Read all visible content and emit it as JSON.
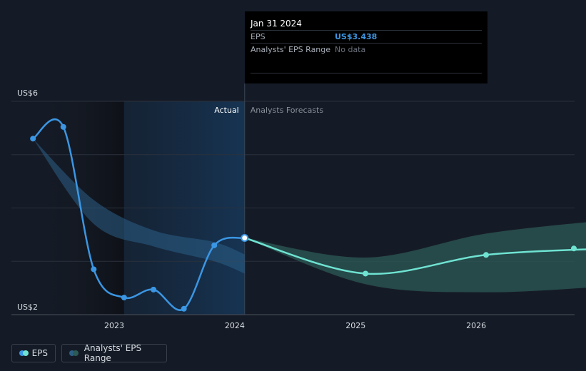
{
  "chart_data": {
    "type": "line",
    "currency_prefix": "US$",
    "y_labels": [
      "US$6",
      "US$2"
    ],
    "ylim": [
      2,
      6
    ],
    "x_ticks": [
      "2023",
      "2024",
      "2025",
      "2026"
    ],
    "regions": {
      "actual_label": "Actual",
      "forecast_label": "Analysts Forecasts"
    },
    "series": [
      {
        "name": "EPS",
        "kind": "actual",
        "color": "#3b96e3",
        "points": [
          {
            "x": "2022-04-30",
            "y": 5.3
          },
          {
            "x": "2022-07-31",
            "y": 5.52
          },
          {
            "x": "2022-10-31",
            "y": 2.85
          },
          {
            "x": "2023-01-31",
            "y": 2.32
          },
          {
            "x": "2023-04-30",
            "y": 2.47
          },
          {
            "x": "2023-07-31",
            "y": 2.11
          },
          {
            "x": "2023-10-31",
            "y": 3.3
          },
          {
            "x": "2024-01-31",
            "y": 3.438
          }
        ]
      },
      {
        "name": "EPS",
        "kind": "forecast",
        "color": "#6fe3d2",
        "points": [
          {
            "x": "2024-01-31",
            "y": 3.438
          },
          {
            "x": "2025-01-31",
            "y": 2.77
          },
          {
            "x": "2026-01-31",
            "y": 3.12
          },
          {
            "x": "2027-01-31",
            "y": 3.24
          }
        ]
      }
    ],
    "past_range_band": {
      "color": "#2b5f86",
      "upper": [
        {
          "x": "2022-04-30",
          "y": 5.3
        },
        {
          "x": "2022-10-31",
          "y": 4.15
        },
        {
          "x": "2023-04-30",
          "y": 3.58
        },
        {
          "x": "2023-10-31",
          "y": 3.36
        },
        {
          "x": "2024-01-31",
          "y": 3.13
        }
      ],
      "lower": [
        {
          "x": "2022-04-30",
          "y": 5.3
        },
        {
          "x": "2022-10-31",
          "y": 3.7
        },
        {
          "x": "2023-04-30",
          "y": 3.28
        },
        {
          "x": "2023-10-31",
          "y": 3.0
        },
        {
          "x": "2024-01-31",
          "y": 2.77
        }
      ]
    },
    "forecast_range_band": {
      "name": "Analysts' EPS Range",
      "color": "#2c5a55",
      "upper": [
        {
          "x": "2024-01-31",
          "y": 3.438
        },
        {
          "x": "2025-01-31",
          "y": 3.07
        },
        {
          "x": "2026-01-31",
          "y": 3.52
        },
        {
          "x": "2027-01-31",
          "y": 3.77
        }
      ],
      "lower": [
        {
          "x": "2024-01-31",
          "y": 3.438
        },
        {
          "x": "2025-01-31",
          "y": 2.57
        },
        {
          "x": "2026-01-31",
          "y": 2.42
        },
        {
          "x": "2027-01-31",
          "y": 2.53
        }
      ]
    },
    "grid": true
  },
  "tooltip": {
    "date": "Jan 31 2024",
    "rows": [
      {
        "label": "EPS",
        "value": "US$3.438"
      },
      {
        "label": "Analysts' EPS Range",
        "value": "No data"
      }
    ]
  },
  "legend": [
    {
      "label": "EPS"
    },
    {
      "label": "Analysts' EPS Range"
    }
  ]
}
